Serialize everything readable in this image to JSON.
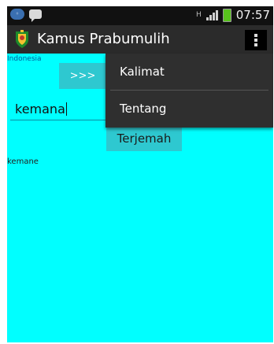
{
  "status_bar": {
    "time": "07:57",
    "network_icon": "wifi-circle-icon",
    "chat_icon": "chat-icon",
    "h_indicator": "H",
    "colors": {
      "background": "#111111",
      "battery": "#58c21d"
    }
  },
  "action_bar": {
    "title": "Kamus Prabumulih",
    "logo_icon": "city-crest-icon",
    "overflow_icon": "overflow-menu-icon",
    "background": "#2b2b2b"
  },
  "main": {
    "language_label": "Indonesia",
    "swap_label": ">>>",
    "input_value": "kemana",
    "translate_label": "Terjemah",
    "result_text": "kemane",
    "colors": {
      "background": "#00ffff",
      "button": "#2ec8d0"
    }
  },
  "overflow_menu": {
    "items": [
      {
        "label": "Kalimat"
      },
      {
        "label": "Tentang"
      }
    ],
    "background": "#2f2f2f"
  }
}
